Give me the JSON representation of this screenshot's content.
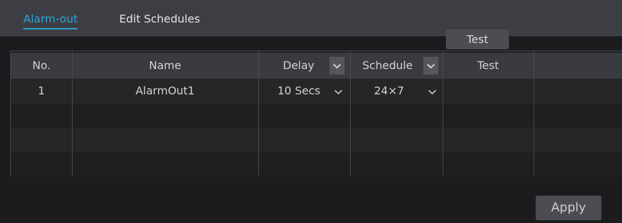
{
  "tabs": [
    {
      "label": "Alarm-out",
      "active": true
    },
    {
      "label": "Edit Schedules",
      "active": false
    }
  ],
  "table": {
    "columns": [
      "No.",
      "Name",
      "Delay",
      "Schedule",
      "Test"
    ],
    "rows": [
      {
        "no": "1",
        "name": "AlarmOut1",
        "delay": "10 Secs",
        "schedule": "24×7",
        "test_label": "Test"
      }
    ]
  },
  "footer": {
    "apply_label": "Apply"
  },
  "colors": {
    "accent": "#2fa3d8",
    "background": "#1c1c1f",
    "tabbar": "#3d3e43"
  },
  "icons": {
    "dropdown": "chevron-down-icon"
  }
}
